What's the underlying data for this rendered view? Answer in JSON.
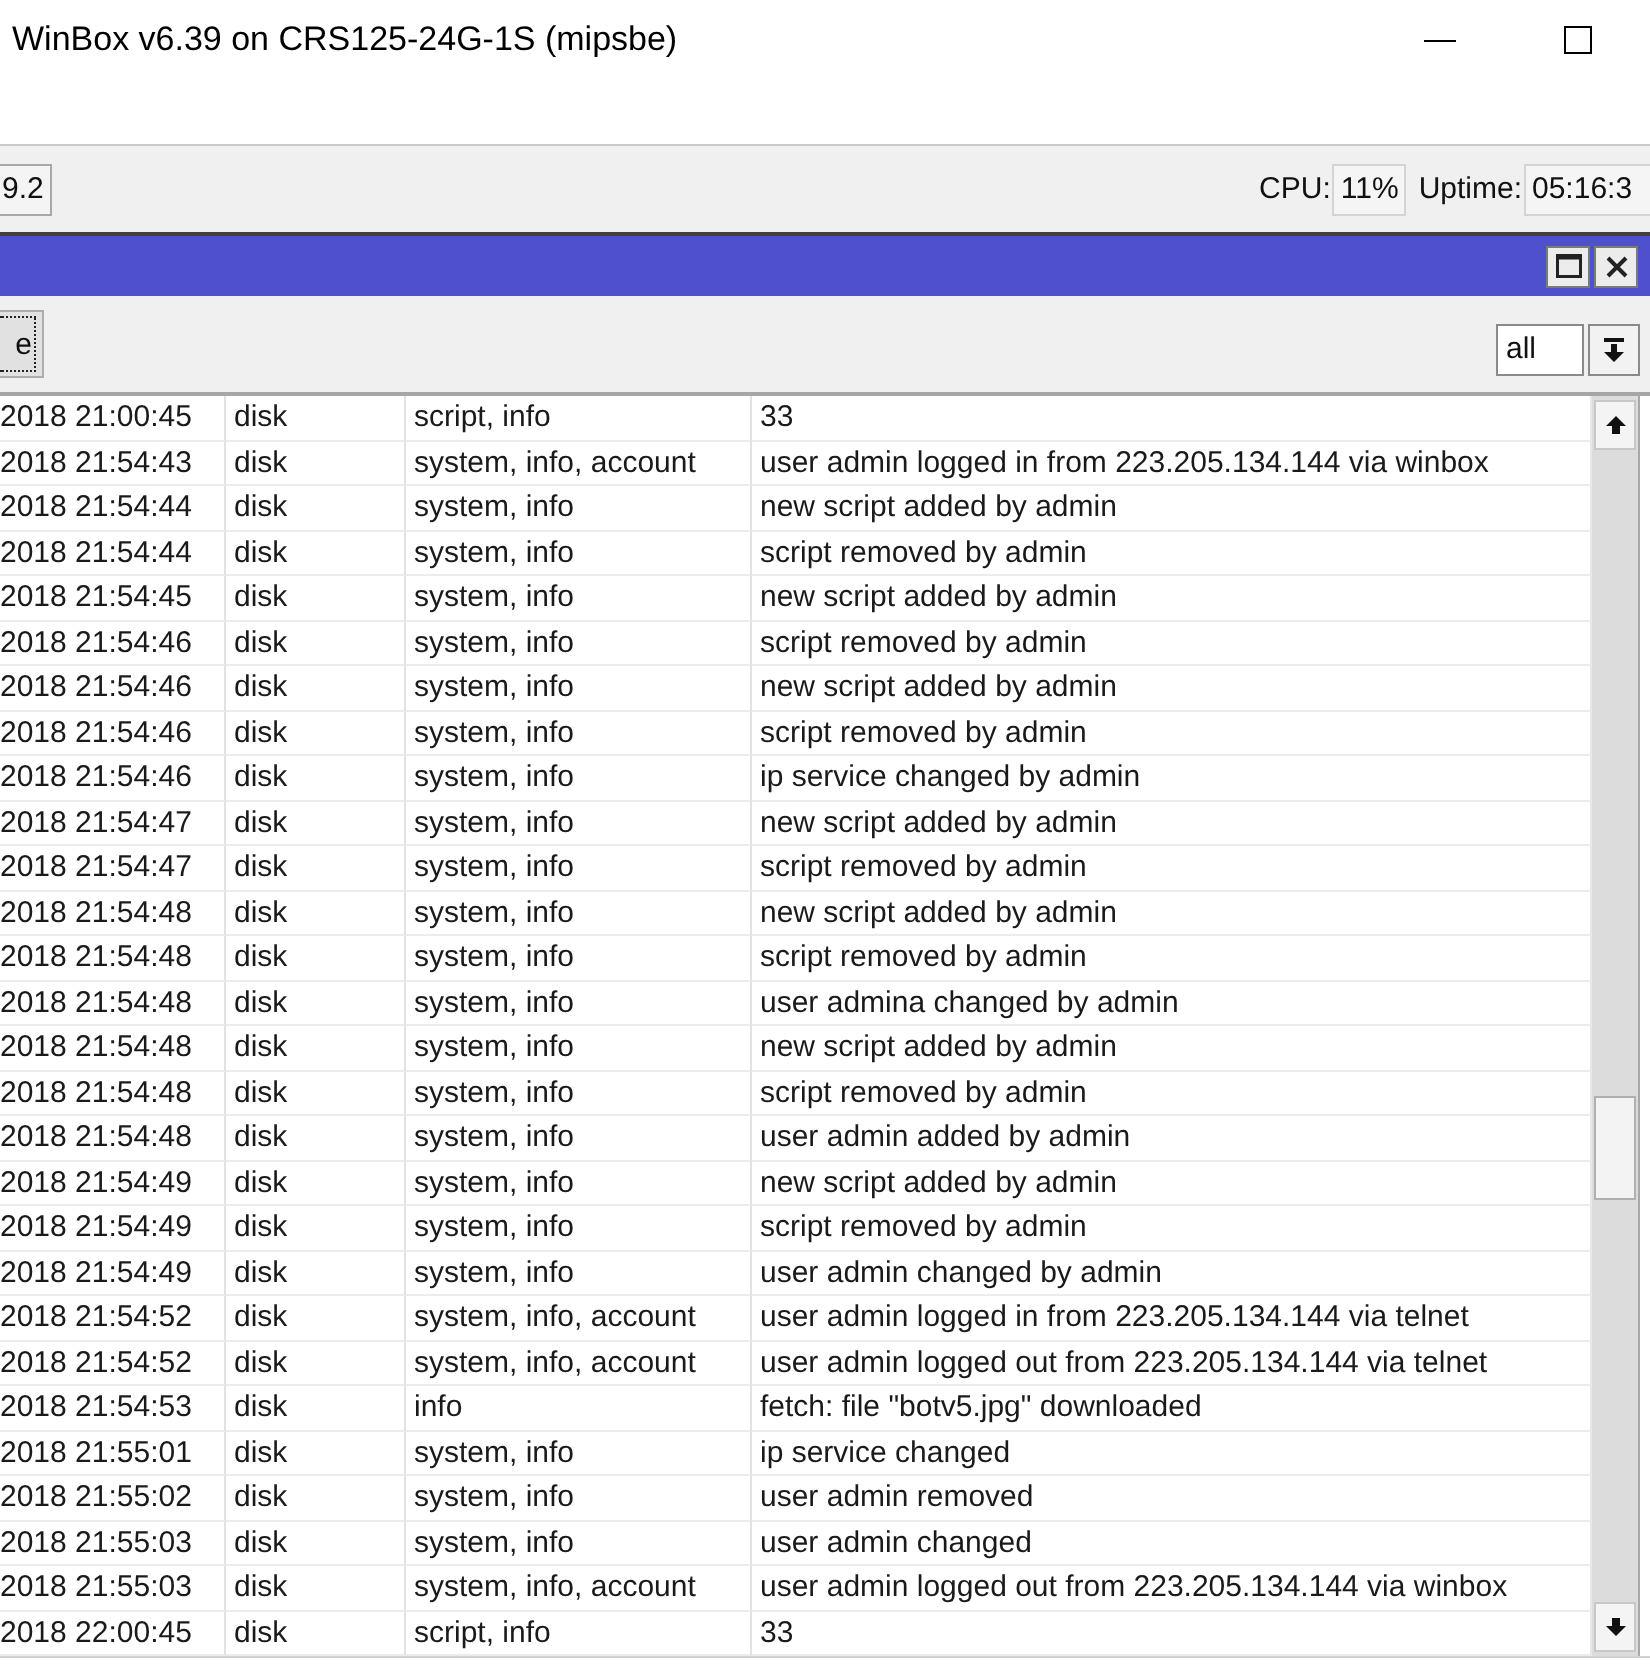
{
  "window": {
    "title": "WinBox v6.39 on CRS125-24G-1S (mipsbe)"
  },
  "status_toolbar": {
    "field_1": "9.2",
    "cpu": {
      "label": "CPU:",
      "value": "11%"
    },
    "uptime": {
      "label": "Uptime:",
      "value": "05:16:3"
    }
  },
  "log_window": {
    "toolbar": {
      "button": {
        "label": "e",
        "focused": true
      },
      "filter": {
        "value": "all"
      }
    },
    "table": {
      "rows": [
        [
          "2018 21:00:45",
          "disk",
          "script, info",
          "33"
        ],
        [
          "2018 21:54:43",
          "disk",
          "system, info, account",
          "user admin logged in from 223.205.134.144 via winbox"
        ],
        [
          "2018 21:54:44",
          "disk",
          "system, info",
          "new script added by admin"
        ],
        [
          "2018 21:54:44",
          "disk",
          "system, info",
          "script removed by admin"
        ],
        [
          "2018 21:54:45",
          "disk",
          "system, info",
          "new script added by admin"
        ],
        [
          "2018 21:54:46",
          "disk",
          "system, info",
          "script removed by admin"
        ],
        [
          "2018 21:54:46",
          "disk",
          "system, info",
          "new script added by admin"
        ],
        [
          "2018 21:54:46",
          "disk",
          "system, info",
          "script removed by admin"
        ],
        [
          "2018 21:54:46",
          "disk",
          "system, info",
          "ip service changed by admin"
        ],
        [
          "2018 21:54:47",
          "disk",
          "system, info",
          "new script added by admin"
        ],
        [
          "2018 21:54:47",
          "disk",
          "system, info",
          "script removed by admin"
        ],
        [
          "2018 21:54:48",
          "disk",
          "system, info",
          "new script added by admin"
        ],
        [
          "2018 21:54:48",
          "disk",
          "system, info",
          "script removed by admin"
        ],
        [
          "2018 21:54:48",
          "disk",
          "system, info",
          "user admina changed by admin"
        ],
        [
          "2018 21:54:48",
          "disk",
          "system, info",
          "new script added by admin"
        ],
        [
          "2018 21:54:48",
          "disk",
          "system, info",
          "script removed by admin"
        ],
        [
          "2018 21:54:48",
          "disk",
          "system, info",
          "user admin added by admin"
        ],
        [
          "2018 21:54:49",
          "disk",
          "system, info",
          "new script added by admin"
        ],
        [
          "2018 21:54:49",
          "disk",
          "system, info",
          "script removed by admin"
        ],
        [
          "2018 21:54:49",
          "disk",
          "system, info",
          "user admin changed by admin"
        ],
        [
          "2018 21:54:52",
          "disk",
          "system, info, account",
          "user admin logged in from 223.205.134.144 via telnet"
        ],
        [
          "2018 21:54:52",
          "disk",
          "system, info, account",
          "user admin logged out from 223.205.134.144 via telnet"
        ],
        [
          "2018 21:54:53",
          "disk",
          "info",
          "fetch: file \"botv5.jpg\" downloaded"
        ],
        [
          "2018 21:55:01",
          "disk",
          "system, info",
          "ip service changed"
        ],
        [
          "2018 21:55:02",
          "disk",
          "system, info",
          "user admin removed"
        ],
        [
          "2018 21:55:03",
          "disk",
          "system, info",
          "user admin changed"
        ],
        [
          "2018 21:55:03",
          "disk",
          "system, info, account",
          "user admin logged out from 223.205.134.144 via winbox"
        ],
        [
          "2018 22:00:45",
          "disk",
          "script, info",
          "33"
        ]
      ]
    }
  }
}
